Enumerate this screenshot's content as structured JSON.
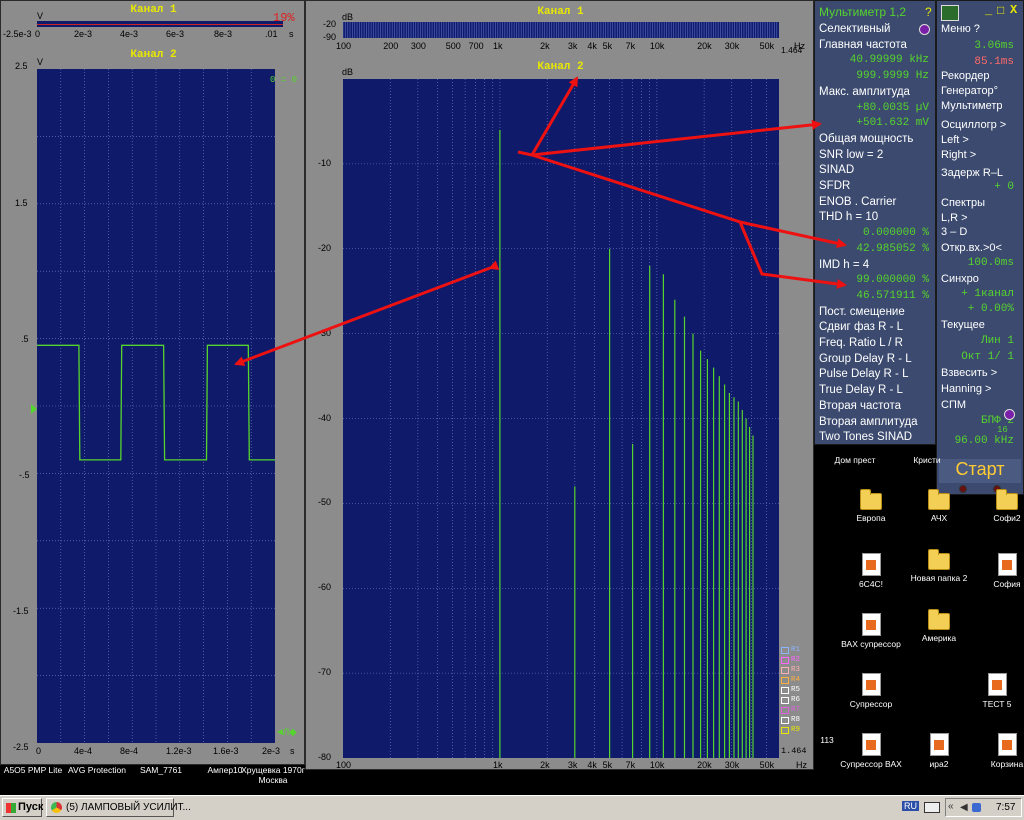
{
  "channels": {
    "ch1": "Канал 1",
    "ch2": "Канал 2"
  },
  "scope_top": {
    "y_unit": "V",
    "time_unit": "s",
    "overflow": "19%",
    "x_ticks": [
      "-2.5e-3",
      "0",
      "2e-3",
      "4e-3",
      "6e-3",
      "8e-3",
      ".01"
    ]
  },
  "scope_main": {
    "y_unit": "V",
    "y_ticks": [
      "2.5",
      "1.5",
      ".5",
      "-.5",
      "-1.5",
      "-2.5"
    ],
    "x_ticks": [
      "0",
      "4e-4",
      "8e-4",
      "1.2e-3",
      "1.6e-3",
      "2e-3"
    ],
    "time_unit": "s",
    "corner_label": "0 = 0",
    "trig_label": "◄Л◆"
  },
  "spec_top": {
    "unit": "dB",
    "y_ticks": [
      "-20",
      "-90"
    ],
    "x_ticks": [
      "100",
      "200",
      "300",
      "500",
      "700",
      "1k",
      "2k",
      "3k",
      "4k",
      "5k",
      "7k",
      "10k",
      "20k",
      "30k",
      "50k"
    ],
    "freq_unit": "Hz"
  },
  "spec_main": {
    "unit": "dB",
    "y_ticks": [
      "-10",
      "-20",
      "-30",
      "-40",
      "-50",
      "-60",
      "-70",
      "-80"
    ],
    "x_ticks": [
      "100",
      "1k",
      "2k",
      "3k",
      "4k",
      "5k",
      "7k",
      "10k",
      "20k",
      "30k",
      "50k"
    ],
    "freq_unit": "Hz",
    "scale_value": "1.464",
    "legend": [
      "R1",
      "R2",
      "R3",
      "R4",
      "R5",
      "R6",
      "R7",
      "R8",
      "R9"
    ],
    "legend_colors": [
      "#8db4ff",
      "#ff66ff",
      "#ffb0b0",
      "#ffb040",
      "#ffffff",
      "#ffffff",
      "#e060e0",
      "#ffffff",
      "#e8e800"
    ]
  },
  "multimeter": {
    "title": "Мультиметр 1,2",
    "help": "?",
    "rows": [
      {
        "t": "Селективный",
        "c": "w"
      },
      {
        "t": "Главная частота",
        "c": "w"
      },
      {
        "t": "40.99999 kHz",
        "c": "g"
      },
      {
        "t": "999.9999 Hz",
        "c": "g"
      },
      {
        "t": "Макс. амплитуда",
        "c": "w"
      },
      {
        "t": "+80.0035 µV",
        "c": "g"
      },
      {
        "t": "+501.632 mV",
        "c": "g"
      },
      {
        "t": "Общая мощность",
        "c": "w"
      },
      {
        "t": "SNR     low =     2",
        "c": "w"
      },
      {
        "t": "SINAD",
        "c": "w"
      },
      {
        "t": "SFDR",
        "c": "w"
      },
      {
        "t": "ENOB . Carrier",
        "c": "w"
      },
      {
        "t": "THD       h =    10",
        "c": "w"
      },
      {
        "t": "0.000000 %",
        "c": "g"
      },
      {
        "t": "42.985052 %",
        "c": "g"
      },
      {
        "t": "IMD       h =     4",
        "c": "w"
      },
      {
        "t": "99.000000 %",
        "c": "g"
      },
      {
        "t": "46.571911 %",
        "c": "g"
      },
      {
        "t": "Пост. смещение",
        "c": "w"
      },
      {
        "t": "Сдвиг фаз R - L",
        "c": "w"
      },
      {
        "t": "Freq. Ratio  L / R",
        "c": "w"
      },
      {
        "t": "Group Delay R - L",
        "c": "w"
      },
      {
        "t": "Pulse Delay R - L",
        "c": "w"
      },
      {
        "t": "True Delay R - L",
        "c": "w"
      },
      {
        "t": "Вторая частота",
        "c": "w"
      },
      {
        "t": "Вторая амплитуда",
        "c": "w"
      },
      {
        "t": "Two Tones SINAD",
        "c": "w"
      }
    ]
  },
  "control_panel": {
    "controls": [
      "_",
      "□",
      "X"
    ],
    "rows": [
      {
        "t": "Меню       ?",
        "c": "w"
      },
      {
        "t": "3.06ms",
        "c": "g"
      },
      {
        "t": "85.1ms",
        "c": "r"
      },
      {
        "t": "Рекордер",
        "c": "w"
      },
      {
        "t": "Генератор°",
        "c": "w"
      },
      {
        "t": "Мультиметр",
        "c": "w"
      },
      {
        "t": "Осциллогр  >",
        "c": "w"
      },
      {
        "t": "Left    >",
        "c": "w"
      },
      {
        "t": "Right   >",
        "c": "w"
      },
      {
        "t": "Задерж R–L",
        "c": "w"
      },
      {
        "t": "+      0",
        "c": "g"
      },
      {
        "t": "Спектры",
        "c": "w"
      },
      {
        "t": "L,R     >",
        "c": "w"
      },
      {
        "t": "3 – D",
        "c": "w"
      },
      {
        "t": "Откр.вх.>0<",
        "c": "w"
      },
      {
        "t": "100.0ms",
        "c": "g"
      },
      {
        "t": "Синхро",
        "c": "w"
      },
      {
        "t": "+ 1канал",
        "c": "g"
      },
      {
        "t": "+ 0.00%",
        "c": "g"
      },
      {
        "t": "Текущее",
        "c": "w"
      },
      {
        "t": "Лин      1",
        "c": "g"
      },
      {
        "t": "Окт  1/ 1",
        "c": "g"
      },
      {
        "t": "Взвесить  >",
        "c": "w"
      },
      {
        "t": "Hanning   >",
        "c": "w"
      },
      {
        "t": "СПМ",
        "c": "w"
      },
      {
        "t": "БПФ  2",
        "c": "g"
      },
      {
        "t": "96.00 kHz",
        "c": "g"
      }
    ],
    "fft_exp": "16",
    "start": "Старт"
  },
  "desktop": {
    "icons": [
      {
        "label": "Дом прест",
        "kind": "none"
      },
      {
        "label": "Кристи",
        "kind": "none"
      },
      {
        "label": "Европа",
        "kind": "folder"
      },
      {
        "label": "АЧХ",
        "kind": "folder"
      },
      {
        "label": "Софи2",
        "kind": "folder"
      },
      {
        "label": "6C4C!",
        "kind": "doc"
      },
      {
        "label": "Новая папка 2",
        "kind": "folder"
      },
      {
        "label": "София",
        "kind": "doc"
      },
      {
        "label": "ВАХ супрессор",
        "kind": "doc"
      },
      {
        "label": "Америка",
        "kind": "folder"
      },
      {
        "label": "Супрессор",
        "kind": "doc"
      },
      {
        "label": "ТЕСТ 5",
        "kind": "doc"
      },
      {
        "label": "113",
        "kind": "none"
      },
      {
        "label": "Супрессор ВАХ",
        "kind": "doc"
      },
      {
        "label": "ира2",
        "kind": "doc"
      },
      {
        "label": "Корзина",
        "kind": "doc"
      }
    ],
    "bottom_labels": [
      "A5O5 PMP Lite",
      "AVG Protection",
      "SAM_7761",
      "Ампер10",
      "Хрущевка 1970г Москва"
    ]
  },
  "taskbar": {
    "start": "Пуск",
    "task": "(5) ЛАМПОВЫЙ УСИЛИТ...",
    "lang": "RU",
    "time": "7:57"
  },
  "chart_data": [
    {
      "type": "line",
      "title": "Канал 2",
      "ylabel": "V",
      "xlabel": "s",
      "x": [
        0,
        0.00044,
        0.00045,
        0.00088,
        0.00089,
        0.00133,
        0.00134,
        0.00178,
        0.00179,
        0.00222,
        0.00223,
        0.0025
      ],
      "series": [
        {
          "values": [
            0.45,
            0.45,
            -0.4,
            -0.4,
            0.45,
            0.45,
            -0.4,
            -0.4,
            0.45,
            0.45,
            -0.4,
            -0.4
          ]
        }
      ],
      "xlim": [
        0,
        0.0025
      ],
      "ylim": [
        -2.5,
        2.5
      ],
      "grid": true
    },
    {
      "type": "bar",
      "title": "Канал 2",
      "ylabel": "dB",
      "xlabel": "Hz",
      "x": [
        1000,
        3000,
        5000,
        7000,
        9000,
        11000,
        13000,
        15000,
        17000,
        19000,
        21000,
        23000,
        25000,
        27000,
        29000,
        31000,
        33000,
        35000,
        37000,
        39000,
        41000
      ],
      "values": [
        -6,
        -48,
        -20,
        -43,
        -22,
        -23,
        -26,
        -28,
        -30,
        -32,
        -33,
        -34,
        -35,
        -36,
        -37,
        -37.5,
        -38,
        -39,
        -40,
        -41,
        -42
      ],
      "xlim": [
        100,
        60000
      ],
      "ylim": [
        -80,
        0
      ],
      "x_scale": "log",
      "grid": true
    }
  ]
}
